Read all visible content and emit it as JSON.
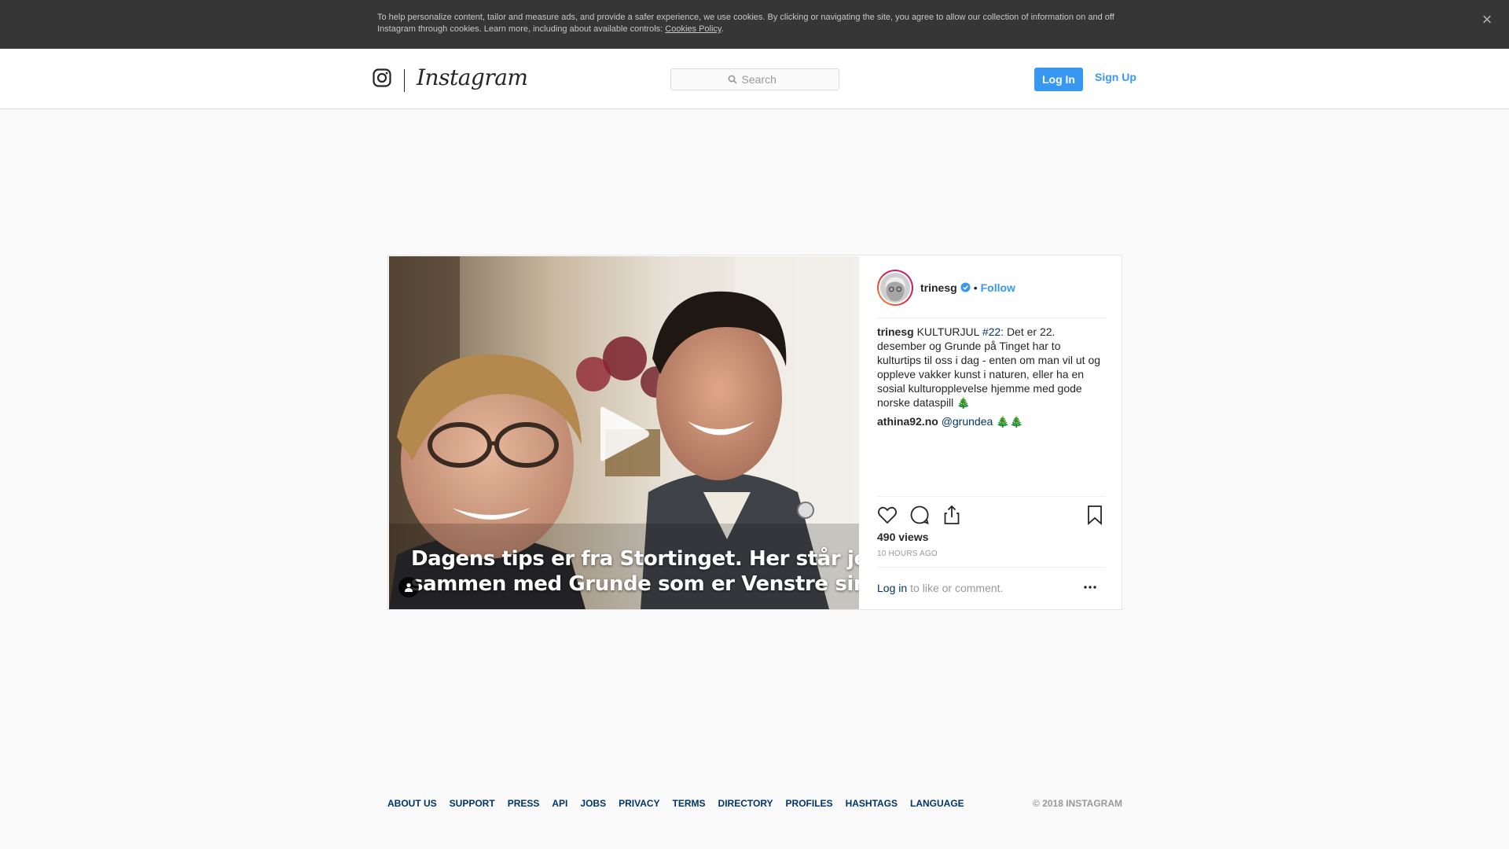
{
  "cookie_banner": {
    "text": "To help personalize content, tailor and measure ads, and provide a safer experience, we use cookies. By clicking or navigating the site, you agree to allow our collection of information on and off Instagram through cookies. Learn more, including about available controls: ",
    "link": "Cookies Policy",
    "suffix": ".",
    "close": "×"
  },
  "header": {
    "wordmark": "Instagram",
    "search_placeholder": "Search",
    "login_label": "Log In",
    "signup_label": "Sign Up"
  },
  "post": {
    "video_caption_line1": "Dagens tips er fra Stortinget. Her står jeg",
    "video_caption_line2": "sammen med Grunde som er Venstre sin",
    "author": "trinesg",
    "dot": "•",
    "follow_label": "Follow",
    "comments": [
      {
        "user": "trinesg",
        "pre": " KULTURJUL ",
        "tag": "#22",
        "text": ": Det er 22. desember og Grunde på Tinget har to kulturtips til oss i dag - enten om man vil ut og oppleve vakker kunst i naturen, eller ha en sosial kulturopplevelse hjemme med gode norske dataspill 🎄"
      },
      {
        "user": "athina92.no",
        "mention": "@grundea",
        "text": " 🎄🎄"
      }
    ],
    "views": "490 views",
    "time_ago": "10 HOURS AGO",
    "login_link": "Log in",
    "login_suffix": "to like or comment."
  },
  "footer": {
    "links": [
      "ABOUT US",
      "SUPPORT",
      "PRESS",
      "API",
      "JOBS",
      "PRIVACY",
      "TERMS",
      "DIRECTORY",
      "PROFILES",
      "HASHTAGS",
      "LANGUAGE"
    ],
    "copyright": "© 2018 INSTAGRAM"
  },
  "colors": {
    "accent": "#3897f0",
    "link_dark": "#003569",
    "banner_bg": "#363636"
  }
}
